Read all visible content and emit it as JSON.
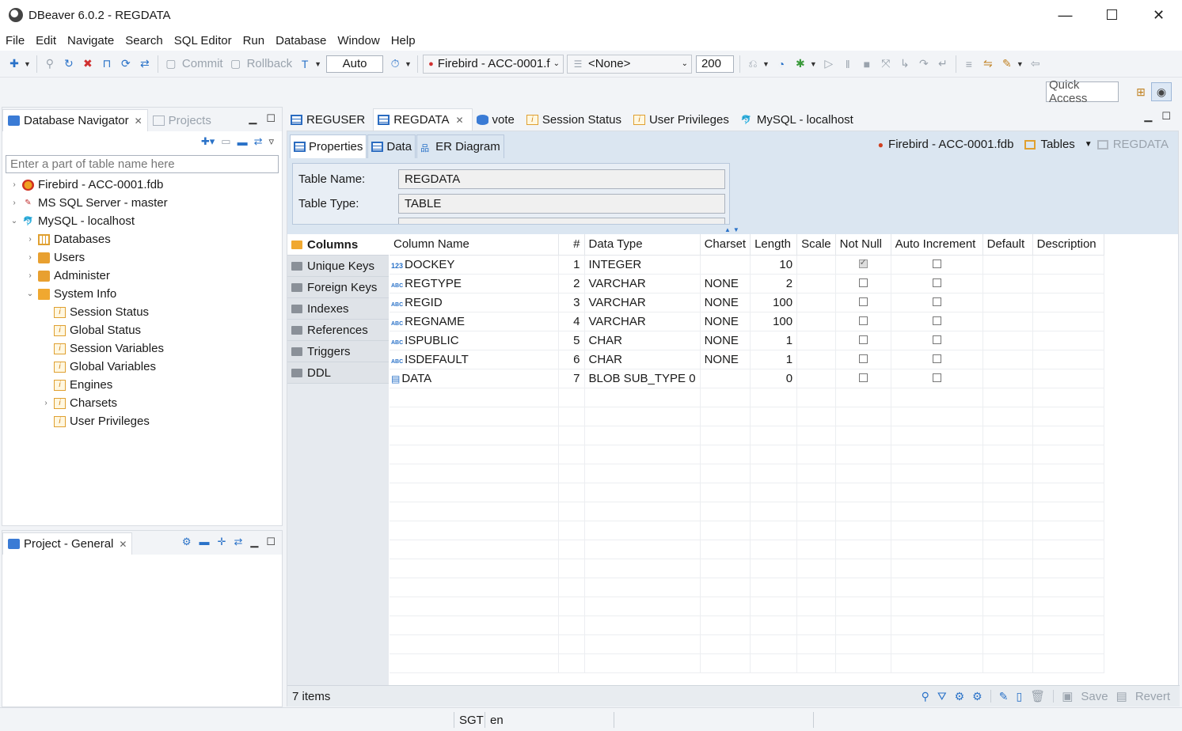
{
  "window": {
    "title": "DBeaver 6.0.2 - REGDATA",
    "min": "—",
    "max": "☐",
    "close": "✕"
  },
  "menu": [
    "File",
    "Edit",
    "Navigate",
    "Search",
    "SQL Editor",
    "Run",
    "Database",
    "Window",
    "Help"
  ],
  "toolbar": {
    "commit": "Commit",
    "rollback": "Rollback",
    "tx_mode": "Auto",
    "connection": "Firebird - ACC-0001.f",
    "schema": "<None>",
    "result_limit": "200"
  },
  "quick_access": "Quick Access",
  "navigator": {
    "tab_label": "Database Navigator",
    "projects_tab": "Projects",
    "filter_placeholder": "Enter a part of table name here",
    "tree": [
      {
        "label": "Firebird - ACC-0001.fdb",
        "depth": 0,
        "toggle": "›",
        "icon": "firebird-icon"
      },
      {
        "label": "MS SQL Server - master",
        "depth": 0,
        "toggle": "›",
        "icon": "mssql-icon"
      },
      {
        "label": "MySQL - localhost",
        "depth": 0,
        "toggle": "⌄",
        "icon": "mysql-icon"
      },
      {
        "label": "Databases",
        "depth": 1,
        "toggle": "›",
        "icon": "databases-icon"
      },
      {
        "label": "Users",
        "depth": 1,
        "toggle": "›",
        "icon": "users-icon"
      },
      {
        "label": "Administer",
        "depth": 1,
        "toggle": "›",
        "icon": "administer-icon"
      },
      {
        "label": "System Info",
        "depth": 1,
        "toggle": "⌄",
        "icon": "folder-icon"
      },
      {
        "label": "Session Status",
        "depth": 2,
        "toggle": "",
        "icon": "info-icon"
      },
      {
        "label": "Global Status",
        "depth": 2,
        "toggle": "",
        "icon": "info-icon"
      },
      {
        "label": "Session Variables",
        "depth": 2,
        "toggle": "",
        "icon": "info-icon"
      },
      {
        "label": "Global Variables",
        "depth": 2,
        "toggle": "",
        "icon": "info-icon"
      },
      {
        "label": "Engines",
        "depth": 2,
        "toggle": "",
        "icon": "info-icon"
      },
      {
        "label": "Charsets",
        "depth": 2,
        "toggle": "›",
        "icon": "info-icon"
      },
      {
        "label": "User Privileges",
        "depth": 2,
        "toggle": "",
        "icon": "info-icon"
      }
    ]
  },
  "project_panel": {
    "tab_label": "Project - General"
  },
  "editor_tabs": [
    {
      "label": "REGUSER",
      "icon": "table-icon",
      "active": false
    },
    {
      "label": "REGDATA",
      "icon": "table-icon",
      "active": true
    },
    {
      "label": "vote",
      "icon": "database-icon",
      "active": false
    },
    {
      "label": "Session Status",
      "icon": "info-icon",
      "active": false
    },
    {
      "label": "User Privileges",
      "icon": "info-icon",
      "active": false
    },
    {
      "label": "MySQL - localhost",
      "icon": "mysql-icon",
      "active": false
    }
  ],
  "sub_tabs": [
    "Properties",
    "Data",
    "ER Diagram"
  ],
  "breadcrumb": {
    "connection": "Firebird - ACC-0001.fdb",
    "folder": "Tables",
    "object": "REGDATA"
  },
  "properties": {
    "table_name_label": "Table Name:",
    "table_name": "REGDATA",
    "table_type_label": "Table Type:",
    "table_type": "TABLE"
  },
  "side_tabs": [
    "Columns",
    "Unique Keys",
    "Foreign Keys",
    "Indexes",
    "References",
    "Triggers",
    "DDL"
  ],
  "columns_table": {
    "headers": [
      "Column Name",
      "#",
      "Data Type",
      "Charset",
      "Length",
      "Scale",
      "Not Null",
      "Auto Increment",
      "Default",
      "Description"
    ],
    "rows": [
      {
        "name": "DOCKEY",
        "type_icon": "123",
        "num": "1",
        "data_type": "INTEGER",
        "charset": "",
        "length": "10",
        "scale": "",
        "not_null": true,
        "auto_inc": false
      },
      {
        "name": "REGTYPE",
        "type_icon": "ABC",
        "num": "2",
        "data_type": "VARCHAR",
        "charset": "NONE",
        "length": "2",
        "scale": "",
        "not_null": false,
        "auto_inc": false
      },
      {
        "name": "REGID",
        "type_icon": "ABC",
        "num": "3",
        "data_type": "VARCHAR",
        "charset": "NONE",
        "length": "100",
        "scale": "",
        "not_null": false,
        "auto_inc": false
      },
      {
        "name": "REGNAME",
        "type_icon": "ABC",
        "num": "4",
        "data_type": "VARCHAR",
        "charset": "NONE",
        "length": "100",
        "scale": "",
        "not_null": false,
        "auto_inc": false
      },
      {
        "name": "ISPUBLIC",
        "type_icon": "ABC",
        "num": "5",
        "data_type": "CHAR",
        "charset": "NONE",
        "length": "1",
        "scale": "",
        "not_null": false,
        "auto_inc": false
      },
      {
        "name": "ISDEFAULT",
        "type_icon": "ABC",
        "num": "6",
        "data_type": "CHAR",
        "charset": "NONE",
        "length": "1",
        "scale": "",
        "not_null": false,
        "auto_inc": false
      },
      {
        "name": "DATA",
        "type_icon": "blob",
        "num": "7",
        "data_type": "BLOB SUB_TYPE 0",
        "charset": "",
        "length": "0",
        "scale": "",
        "not_null": false,
        "auto_inc": false
      }
    ]
  },
  "status": {
    "items": "7 items",
    "save": "Save",
    "revert": "Revert"
  },
  "bottom_bar": {
    "timezone": "SGT",
    "locale": "en"
  }
}
